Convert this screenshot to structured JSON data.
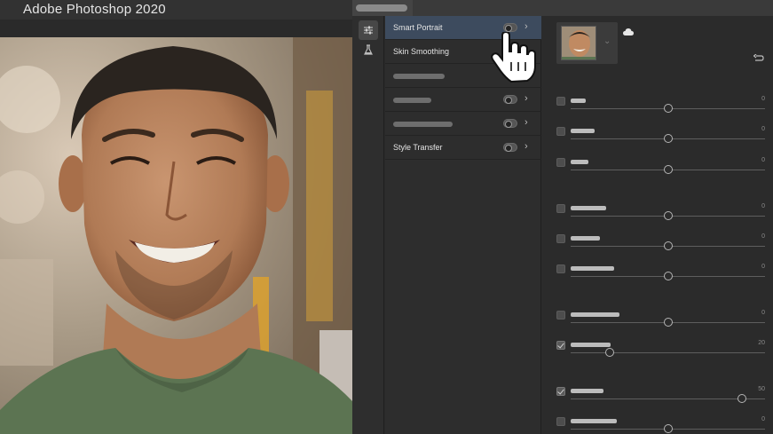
{
  "window": {
    "title": "Adobe Photoshop 2020"
  },
  "filters": [
    {
      "label": "Smart Portrait",
      "selected": true,
      "toggle": "off"
    },
    {
      "label": "Skin Smoothing",
      "selected": false,
      "toggle": "off"
    },
    {
      "label": "",
      "selected": false,
      "toggle": "off"
    },
    {
      "label": "",
      "selected": false,
      "toggle": "off"
    },
    {
      "label": "",
      "selected": false,
      "toggle": "off"
    },
    {
      "label": "Style Transfer",
      "selected": false,
      "toggle": "off"
    }
  ],
  "adjustments": [
    {
      "value": "0",
      "checked": false,
      "level": 0.5
    },
    {
      "value": "0",
      "checked": false,
      "level": 0.5
    },
    {
      "value": "0",
      "checked": false,
      "level": 0.5
    },
    {
      "value": "0",
      "checked": false,
      "level": 0.5
    },
    {
      "value": "0",
      "checked": false,
      "level": 0.5
    },
    {
      "value": "0",
      "checked": false,
      "level": 0.5
    },
    {
      "value": "0",
      "checked": false,
      "level": 0.5
    },
    {
      "value": "20",
      "checked": true,
      "level": 0.2
    },
    {
      "value": "50",
      "checked": true,
      "level": 0.88
    },
    {
      "value": "0",
      "checked": false,
      "level": 0.5
    }
  ],
  "icons": {
    "toolbar": [
      "sliders-icon",
      "flask-icon"
    ],
    "panel": [
      "cloud-icon",
      "reset-icon",
      "chevron-down-icon"
    ],
    "cursor": "hand-pointer-icon"
  },
  "colors": {
    "selected_row": "#3d4b5e",
    "panel_bg": "#2d2d2d",
    "shirt": "#5c7452"
  }
}
